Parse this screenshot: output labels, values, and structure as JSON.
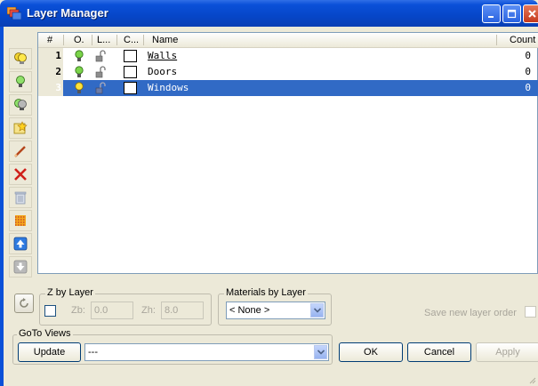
{
  "window": {
    "title": "Layer Manager"
  },
  "toolbar": {
    "items": [
      {
        "name": "layers-all-on-icon"
      },
      {
        "name": "layer-on-icon"
      },
      {
        "name": "layers-isolate-icon"
      },
      {
        "name": "new-layer-icon"
      },
      {
        "name": "edit-layer-icon"
      },
      {
        "name": "delete-layer-icon"
      },
      {
        "name": "purge-layer-icon"
      },
      {
        "name": "layer-pattern-icon"
      },
      {
        "name": "move-up-icon"
      },
      {
        "name": "move-down-icon"
      }
    ]
  },
  "grid": {
    "columns": {
      "num": "#",
      "on": "O.",
      "lock": "L...",
      "color": "C...",
      "name": "Name",
      "count": "Count"
    },
    "rows": [
      {
        "num": "1",
        "name": "Walls",
        "count": "0",
        "selected": false
      },
      {
        "num": "2",
        "name": "Doors",
        "count": "0",
        "selected": false
      },
      {
        "num": "3",
        "name": "Windows",
        "count": "0",
        "selected": true
      }
    ]
  },
  "z_by_layer": {
    "label": "Z by Layer",
    "zb_label": "Zb:",
    "zb_value": "0.0",
    "zh_label": "Zh:",
    "zh_value": "8.0"
  },
  "materials": {
    "label": "Materials by Layer",
    "selected": "< None >"
  },
  "save_order": {
    "label": "Save new layer order"
  },
  "goto_views": {
    "label": "GoTo Views",
    "update_label": "Update",
    "selected": "---"
  },
  "buttons": {
    "ok": "OK",
    "cancel": "Cancel",
    "apply": "Apply"
  }
}
